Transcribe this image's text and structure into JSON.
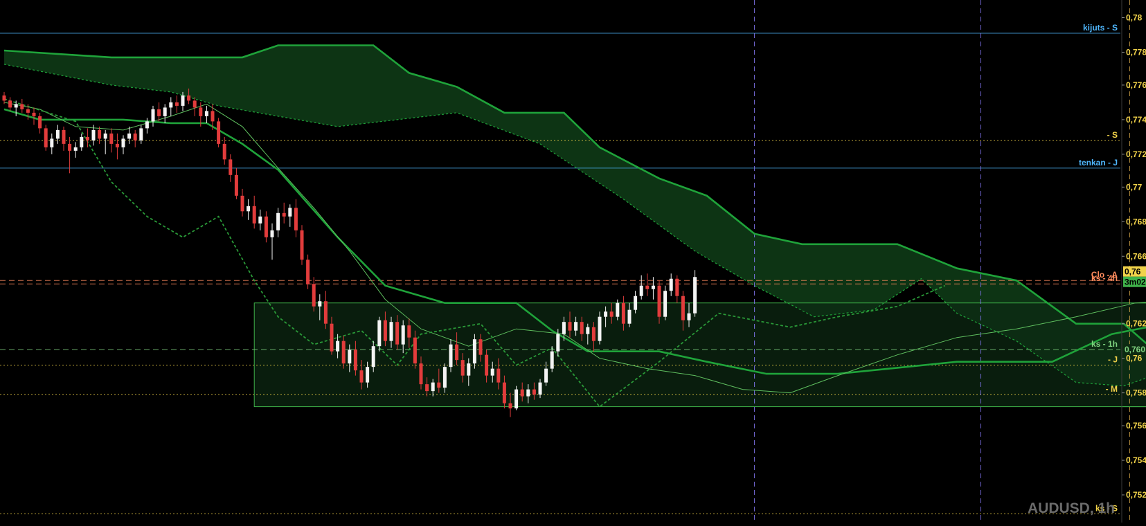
{
  "window": {
    "symbol_label": "AUDUSD, 1h"
  },
  "colors": {
    "background": "#000000",
    "cloud_fill": "#0f3d18",
    "box_fill": "#0d2a12",
    "box_stroke": "#3fb24a",
    "span_line": "#1fa33a",
    "lagging_line": "#2a9a38",
    "tenkan_line": "#5fbf5f",
    "bull_candle": "#f4f4f4",
    "bear_candle": "#e23c3c",
    "axis_text": "#f2d34a",
    "label_yellow": "#f2d34a",
    "label_blue": "#4fb8ff",
    "label_green": "#7fd27f",
    "label_orange": "#ff8a5c",
    "vline_purple": "#8a7cff",
    "vline_orange": "#d9a94a",
    "close_line": "#e6a36a"
  },
  "chart_data": {
    "type": "candlestick",
    "symbol": "AUDUSD",
    "timeframe": "1h",
    "ylim": [
      0.7505,
      0.7802
    ],
    "y_ticks": [
      {
        "value": 0.7795,
        "label": "0,78"
      },
      {
        "value": 0.7775,
        "label": "0,778"
      },
      {
        "value": 0.7756,
        "label": "0,776"
      },
      {
        "value": 0.7736,
        "label": "0,774"
      },
      {
        "value": 0.7716,
        "label": "0,772"
      },
      {
        "value": 0.7697,
        "label": "0,77"
      },
      {
        "value": 0.7677,
        "label": "0,768"
      },
      {
        "value": 0.7657,
        "label": "0,766"
      },
      {
        "value": 0.7618,
        "label": "0,762"
      },
      {
        "value": 0.7598,
        "label": "0,76"
      },
      {
        "value": 0.7578,
        "label": "0,758"
      },
      {
        "value": 0.7559,
        "label": "0,756"
      },
      {
        "value": 0.7539,
        "label": "0,754"
      },
      {
        "value": 0.7519,
        "label": "0,752"
      }
    ],
    "price_badges": [
      {
        "value": 0.7648,
        "label": "0,76",
        "bg": "#f2d34a",
        "fg": "#000000"
      },
      {
        "value": 0.7642,
        "label": "3m02",
        "bg": "#3fb24a",
        "fg": "#000000"
      },
      {
        "value": 0.7603,
        "label": "0,760",
        "bg": "#0d2a12",
        "fg": "#7fd27f"
      }
    ],
    "levels": [
      {
        "value": 0.7786,
        "label": "kijuts - S",
        "color": "#4fb8ff",
        "style": "solid"
      },
      {
        "value": 0.7724,
        "label": "- S",
        "color": "#f2d34a",
        "style": "dotted"
      },
      {
        "value": 0.7708,
        "label": "tenkan - J",
        "color": "#4fb8ff",
        "style": "solid"
      },
      {
        "value": 0.7643,
        "label": "Clo - A",
        "color": "#ff8a5c",
        "style": "dashed"
      },
      {
        "value": 0.7641,
        "label": "ks - 4h",
        "color": "#ff8a5c",
        "style": "dashed"
      },
      {
        "value": 0.7603,
        "label": "ks - 1h",
        "color": "#7fd27f",
        "style": "dashed"
      },
      {
        "value": 0.7594,
        "label": "- J",
        "color": "#f2d34a",
        "style": "dotted"
      },
      {
        "value": 0.7577,
        "label": "- M",
        "color": "#f2d34a",
        "style": "dotted"
      },
      {
        "value": 0.7508,
        "label": "ks - S",
        "color": "#f2d34a",
        "style": "dotted"
      }
    ],
    "box": {
      "x0": 42,
      "x1": 300,
      "y_high": 0.763,
      "y_low": 0.757
    },
    "vertical_markers": [
      {
        "x": 126,
        "color": "#8a7cff"
      },
      {
        "x": 164,
        "color": "#8a7cff"
      },
      {
        "x": 189,
        "color": "#d9a94a"
      }
    ],
    "candles": [
      [
        0.775,
        0.7752,
        0.7745,
        0.7747
      ],
      [
        0.7747,
        0.7749,
        0.7741,
        0.7743
      ],
      [
        0.7743,
        0.7747,
        0.7738,
        0.7745
      ],
      [
        0.7745,
        0.7748,
        0.774,
        0.7742
      ],
      [
        0.7742,
        0.7745,
        0.7736,
        0.774
      ],
      [
        0.774,
        0.7743,
        0.7733,
        0.7738
      ],
      [
        0.7738,
        0.774,
        0.7728,
        0.7731
      ],
      [
        0.7731,
        0.7733,
        0.7718,
        0.772
      ],
      [
        0.772,
        0.7728,
        0.7716,
        0.7725
      ],
      [
        0.7725,
        0.7733,
        0.7722,
        0.773
      ],
      [
        0.773,
        0.7732,
        0.7718,
        0.7722
      ],
      [
        0.7722,
        0.7726,
        0.7705,
        0.7718
      ],
      [
        0.7718,
        0.7723,
        0.7714,
        0.772
      ],
      [
        0.772,
        0.7728,
        0.7718,
        0.7726
      ],
      [
        0.7726,
        0.7731,
        0.772,
        0.7724
      ],
      [
        0.7724,
        0.7733,
        0.7721,
        0.773
      ],
      [
        0.773,
        0.7732,
        0.7722,
        0.7725
      ],
      [
        0.7725,
        0.773,
        0.7716,
        0.7728
      ],
      [
        0.7728,
        0.7731,
        0.7717,
        0.7722
      ],
      [
        0.7722,
        0.7728,
        0.7713,
        0.772
      ],
      [
        0.772,
        0.7727,
        0.7716,
        0.7725
      ],
      [
        0.7725,
        0.7732,
        0.7722,
        0.7728
      ],
      [
        0.7728,
        0.773,
        0.772,
        0.7724
      ],
      [
        0.7724,
        0.7733,
        0.7722,
        0.7731
      ],
      [
        0.7731,
        0.7737,
        0.7728,
        0.7735
      ],
      [
        0.7735,
        0.7744,
        0.7732,
        0.7742
      ],
      [
        0.7742,
        0.7746,
        0.7735,
        0.7738
      ],
      [
        0.7738,
        0.7745,
        0.7734,
        0.7743
      ],
      [
        0.7743,
        0.7749,
        0.7738,
        0.7746
      ],
      [
        0.7746,
        0.775,
        0.774,
        0.7744
      ],
      [
        0.7744,
        0.7752,
        0.7741,
        0.775
      ],
      [
        0.775,
        0.7754,
        0.7745,
        0.7747
      ],
      [
        0.7747,
        0.7749,
        0.7738,
        0.7743
      ],
      [
        0.7743,
        0.7746,
        0.7732,
        0.7738
      ],
      [
        0.7738,
        0.7744,
        0.7734,
        0.7741
      ],
      [
        0.7741,
        0.7745,
        0.773,
        0.7735
      ],
      [
        0.7735,
        0.7737,
        0.772,
        0.7722
      ],
      [
        0.7722,
        0.7726,
        0.771,
        0.7713
      ],
      [
        0.7713,
        0.7716,
        0.77,
        0.7704
      ],
      [
        0.7704,
        0.7708,
        0.769,
        0.7692
      ],
      [
        0.7692,
        0.7696,
        0.768,
        0.7683
      ],
      [
        0.7683,
        0.769,
        0.7678,
        0.7686
      ],
      [
        0.7686,
        0.7692,
        0.7673,
        0.7676
      ],
      [
        0.7676,
        0.7684,
        0.7672,
        0.768
      ],
      [
        0.768,
        0.7683,
        0.7665,
        0.7668
      ],
      [
        0.7668,
        0.7676,
        0.7655,
        0.7672
      ],
      [
        0.7672,
        0.7685,
        0.7668,
        0.7682
      ],
      [
        0.7682,
        0.7688,
        0.7676,
        0.768
      ],
      [
        0.768,
        0.7687,
        0.7674,
        0.7685
      ],
      [
        0.7685,
        0.769,
        0.7668,
        0.7672
      ],
      [
        0.7672,
        0.7675,
        0.7652,
        0.7655
      ],
      [
        0.7655,
        0.7658,
        0.7638,
        0.7641
      ],
      [
        0.7641,
        0.7645,
        0.7625,
        0.7628
      ],
      [
        0.7628,
        0.7635,
        0.762,
        0.7631
      ],
      [
        0.7631,
        0.7637,
        0.7615,
        0.7618
      ],
      [
        0.7618,
        0.7622,
        0.76,
        0.7602
      ],
      [
        0.7602,
        0.7612,
        0.7598,
        0.7608
      ],
      [
        0.7608,
        0.7611,
        0.7592,
        0.7595
      ],
      [
        0.7595,
        0.7606,
        0.759,
        0.7603
      ],
      [
        0.7603,
        0.7608,
        0.7588,
        0.7591
      ],
      [
        0.7591,
        0.7597,
        0.758,
        0.7584
      ],
      [
        0.7584,
        0.7596,
        0.7581,
        0.7593
      ],
      [
        0.7593,
        0.7608,
        0.759,
        0.7605
      ],
      [
        0.7605,
        0.7622,
        0.7602,
        0.762
      ],
      [
        0.762,
        0.7625,
        0.7605,
        0.7608
      ],
      [
        0.7608,
        0.7622,
        0.7604,
        0.7619
      ],
      [
        0.7619,
        0.7623,
        0.7603,
        0.7606
      ],
      [
        0.7606,
        0.762,
        0.7601,
        0.7617
      ],
      [
        0.7617,
        0.7621,
        0.7604,
        0.761
      ],
      [
        0.761,
        0.7614,
        0.7592,
        0.7595
      ],
      [
        0.7595,
        0.7599,
        0.758,
        0.7583
      ],
      [
        0.7583,
        0.7587,
        0.7576,
        0.7579
      ],
      [
        0.7579,
        0.7586,
        0.7576,
        0.7584
      ],
      [
        0.7584,
        0.7592,
        0.7578,
        0.7581
      ],
      [
        0.7581,
        0.7595,
        0.7578,
        0.7593
      ],
      [
        0.7593,
        0.7609,
        0.759,
        0.7606
      ],
      [
        0.7606,
        0.7613,
        0.7594,
        0.7597
      ],
      [
        0.7597,
        0.7601,
        0.7584,
        0.7588
      ],
      [
        0.7588,
        0.7598,
        0.7582,
        0.7595
      ],
      [
        0.7595,
        0.7612,
        0.7592,
        0.7609
      ],
      [
        0.7609,
        0.7612,
        0.7596,
        0.76
      ],
      [
        0.76,
        0.7603,
        0.7584,
        0.7588
      ],
      [
        0.7588,
        0.7596,
        0.7584,
        0.7592
      ],
      [
        0.7592,
        0.7598,
        0.758,
        0.7584
      ],
      [
        0.7584,
        0.7588,
        0.7569,
        0.7572
      ],
      [
        0.7572,
        0.7578,
        0.7564,
        0.7569
      ],
      [
        0.7569,
        0.7582,
        0.7568,
        0.758
      ],
      [
        0.758,
        0.7584,
        0.7573,
        0.7576
      ],
      [
        0.7576,
        0.7583,
        0.7572,
        0.758
      ],
      [
        0.758,
        0.7584,
        0.7574,
        0.7577
      ],
      [
        0.7577,
        0.7586,
        0.7575,
        0.7584
      ],
      [
        0.7584,
        0.7596,
        0.7582,
        0.7592
      ],
      [
        0.7592,
        0.7605,
        0.759,
        0.7602
      ],
      [
        0.7602,
        0.7615,
        0.7599,
        0.7612
      ],
      [
        0.7612,
        0.7622,
        0.7608,
        0.7619
      ],
      [
        0.7619,
        0.7625,
        0.761,
        0.7614
      ],
      [
        0.7614,
        0.7622,
        0.7611,
        0.7619
      ],
      [
        0.7619,
        0.7622,
        0.7608,
        0.7612
      ],
      [
        0.7612,
        0.7618,
        0.7606,
        0.7616
      ],
      [
        0.7616,
        0.7619,
        0.7602,
        0.7608
      ],
      [
        0.7608,
        0.7625,
        0.7606,
        0.7622
      ],
      [
        0.7622,
        0.7628,
        0.7616,
        0.7625
      ],
      [
        0.7625,
        0.763,
        0.7618,
        0.7622
      ],
      [
        0.7622,
        0.7632,
        0.762,
        0.763
      ],
      [
        0.763,
        0.7634,
        0.7614,
        0.7618
      ],
      [
        0.7618,
        0.763,
        0.7616,
        0.7626
      ],
      [
        0.7626,
        0.7637,
        0.7624,
        0.7634
      ],
      [
        0.7634,
        0.7646,
        0.7632,
        0.764
      ],
      [
        0.764,
        0.7647,
        0.7634,
        0.7638
      ],
      [
        0.7638,
        0.7645,
        0.7632,
        0.764
      ],
      [
        0.764,
        0.7643,
        0.7618,
        0.7622
      ],
      [
        0.7622,
        0.764,
        0.762,
        0.7637
      ],
      [
        0.7637,
        0.7647,
        0.7634,
        0.7644
      ],
      [
        0.7644,
        0.7646,
        0.763,
        0.7634
      ],
      [
        0.7634,
        0.7637,
        0.7614,
        0.762
      ],
      [
        0.762,
        0.763,
        0.7616,
        0.7624
      ],
      [
        0.7624,
        0.7649,
        0.7622,
        0.7645
      ]
    ],
    "kijun": [
      [
        0,
        0.7742
      ],
      [
        6,
        0.7736
      ],
      [
        20,
        0.7736
      ],
      [
        28,
        0.7734
      ],
      [
        34,
        0.7734
      ],
      [
        40,
        0.7722
      ],
      [
        46,
        0.7707
      ],
      [
        56,
        0.7668
      ],
      [
        64,
        0.764
      ],
      [
        74,
        0.763
      ],
      [
        86,
        0.763
      ],
      [
        92,
        0.7614
      ],
      [
        98,
        0.7602
      ],
      [
        110,
        0.7602
      ],
      [
        118,
        0.7596
      ],
      [
        128,
        0.7589
      ],
      [
        140,
        0.7589
      ],
      [
        160,
        0.7596
      ],
      [
        176,
        0.7596
      ],
      [
        186,
        0.7612
      ],
      [
        198,
        0.762
      ]
    ],
    "tenkan": [
      [
        0,
        0.7746
      ],
      [
        6,
        0.7742
      ],
      [
        12,
        0.7732
      ],
      [
        20,
        0.773
      ],
      [
        28,
        0.7738
      ],
      [
        34,
        0.7745
      ],
      [
        40,
        0.7732
      ],
      [
        46,
        0.7708
      ],
      [
        52,
        0.7685
      ],
      [
        58,
        0.766
      ],
      [
        64,
        0.7632
      ],
      [
        70,
        0.7615
      ],
      [
        78,
        0.7605
      ],
      [
        86,
        0.7615
      ],
      [
        94,
        0.7612
      ],
      [
        100,
        0.7598
      ],
      [
        108,
        0.7592
      ],
      [
        116,
        0.7588
      ],
      [
        124,
        0.758
      ],
      [
        132,
        0.7578
      ],
      [
        140,
        0.7588
      ],
      [
        150,
        0.76
      ],
      [
        160,
        0.761
      ],
      [
        170,
        0.7615
      ],
      [
        180,
        0.7622
      ],
      [
        190,
        0.763
      ],
      [
        198,
        0.7632
      ]
    ],
    "span_a": [
      [
        0,
        0.7768
      ],
      [
        18,
        0.7756
      ],
      [
        28,
        0.7752
      ],
      [
        36,
        0.7744
      ],
      [
        46,
        0.7738
      ],
      [
        56,
        0.7732
      ],
      [
        66,
        0.7736
      ],
      [
        76,
        0.774
      ],
      [
        90,
        0.7722
      ],
      [
        104,
        0.769
      ],
      [
        116,
        0.766
      ],
      [
        126,
        0.764
      ],
      [
        136,
        0.7622
      ],
      [
        146,
        0.7626
      ],
      [
        154,
        0.7644
      ],
      [
        160,
        0.7624
      ],
      [
        170,
        0.7608
      ],
      [
        180,
        0.7584
      ],
      [
        188,
        0.7582
      ],
      [
        198,
        0.7594
      ],
      [
        214,
        0.7602
      ],
      [
        228,
        0.7616
      ],
      [
        240,
        0.763
      ],
      [
        246,
        0.7626
      ]
    ],
    "span_b": [
      [
        0,
        0.7776
      ],
      [
        18,
        0.7772
      ],
      [
        40,
        0.7772
      ],
      [
        46,
        0.7779
      ],
      [
        62,
        0.7779
      ],
      [
        68,
        0.7763
      ],
      [
        76,
        0.7755
      ],
      [
        84,
        0.774
      ],
      [
        94,
        0.774
      ],
      [
        100,
        0.772
      ],
      [
        110,
        0.7702
      ],
      [
        118,
        0.7692
      ],
      [
        126,
        0.767
      ],
      [
        134,
        0.7664
      ],
      [
        150,
        0.7664
      ],
      [
        160,
        0.765
      ],
      [
        170,
        0.7643
      ],
      [
        180,
        0.7618
      ],
      [
        188,
        0.7618
      ],
      [
        196,
        0.7594
      ],
      [
        204,
        0.7592
      ],
      [
        218,
        0.7592
      ],
      [
        230,
        0.76
      ],
      [
        246,
        0.7602
      ]
    ],
    "chikou": [
      [
        0,
        0.7748
      ],
      [
        12,
        0.7735
      ],
      [
        18,
        0.77
      ],
      [
        24,
        0.768
      ],
      [
        30,
        0.7668
      ],
      [
        36,
        0.768
      ],
      [
        42,
        0.7643
      ],
      [
        46,
        0.7622
      ],
      [
        52,
        0.7606
      ],
      [
        60,
        0.7614
      ],
      [
        66,
        0.7594
      ],
      [
        70,
        0.7612
      ],
      [
        80,
        0.7618
      ],
      [
        86,
        0.7594
      ],
      [
        92,
        0.7604
      ],
      [
        100,
        0.757
      ],
      [
        110,
        0.7596
      ],
      [
        120,
        0.7624
      ],
      [
        132,
        0.7616
      ],
      [
        140,
        0.7622
      ],
      [
        150,
        0.7628
      ],
      [
        158,
        0.764
      ]
    ]
  }
}
